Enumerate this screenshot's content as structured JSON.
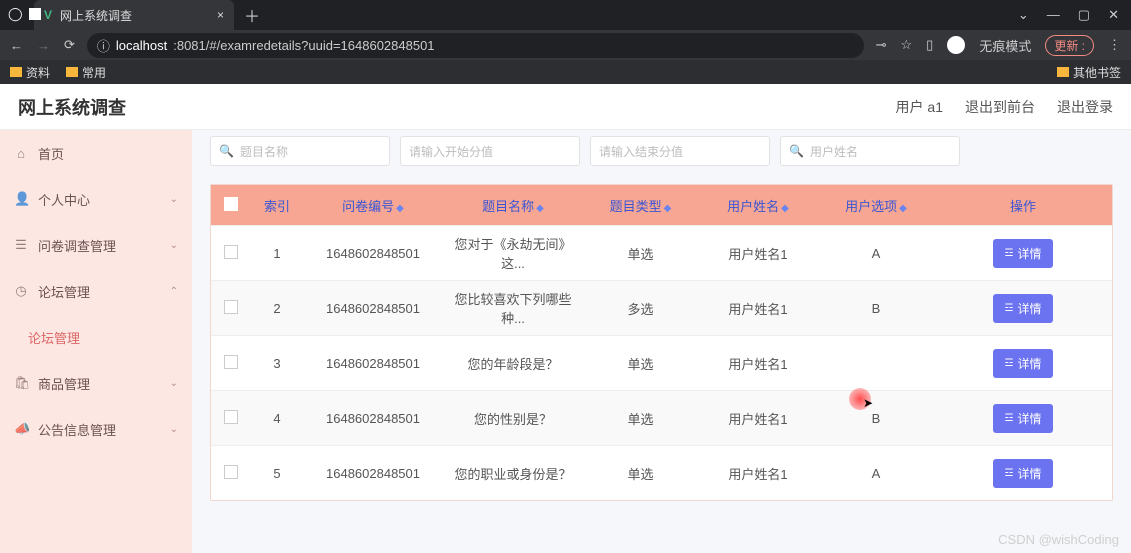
{
  "browser": {
    "tab_title": "网上系统调查",
    "url_host": "localhost",
    "url_rest": ":8081/#/examredetails?uuid=1648602848501",
    "mode_label": "无痕模式",
    "refresh_label": "更新 :",
    "bookmarks": {
      "b1": "资料",
      "b2": "常用",
      "other": "其他书签"
    }
  },
  "header": {
    "title": "网上系统调查",
    "user_label": "用户 a1",
    "to_front": "退出到前台",
    "logout": "退出登录"
  },
  "sidebar": {
    "home": "首页",
    "personal": "个人中心",
    "survey_mgmt": "问卷调查管理",
    "forum_mgmt": "论坛管理",
    "forum_sub": "论坛管理",
    "goods_mgmt": "商品管理",
    "notice_mgmt": "公告信息管理"
  },
  "filters": {
    "f1": "题目名称",
    "f2": "请输入开始分值",
    "f3": "请输入结束分值",
    "f4": "用户姓名"
  },
  "table": {
    "head": {
      "index": "索引",
      "id": "问卷编号",
      "name": "题目名称",
      "type": "题目类型",
      "user": "用户姓名",
      "option": "用户选项",
      "action": "操作"
    },
    "detail_label": "详情",
    "rows": [
      {
        "idx": "1",
        "id": "1648602848501",
        "name": "您对于《永劫无间》这...",
        "type": "单选",
        "user": "用户姓名1",
        "opt": "A"
      },
      {
        "idx": "2",
        "id": "1648602848501",
        "name": "您比较喜欢下列哪些种...",
        "type": "多选",
        "user": "用户姓名1",
        "opt": "B"
      },
      {
        "idx": "3",
        "id": "1648602848501",
        "name": "您的年龄段是？",
        "type": "单选",
        "user": "用户姓名1",
        "opt": ""
      },
      {
        "idx": "4",
        "id": "1648602848501",
        "name": "您的性别是？",
        "type": "单选",
        "user": "用户姓名1",
        "opt": "B"
      },
      {
        "idx": "5",
        "id": "1648602848501",
        "name": "您的职业或身份是？",
        "type": "单选",
        "user": "用户姓名1",
        "opt": "A"
      }
    ]
  },
  "watermark": "CSDN @wishCoding"
}
